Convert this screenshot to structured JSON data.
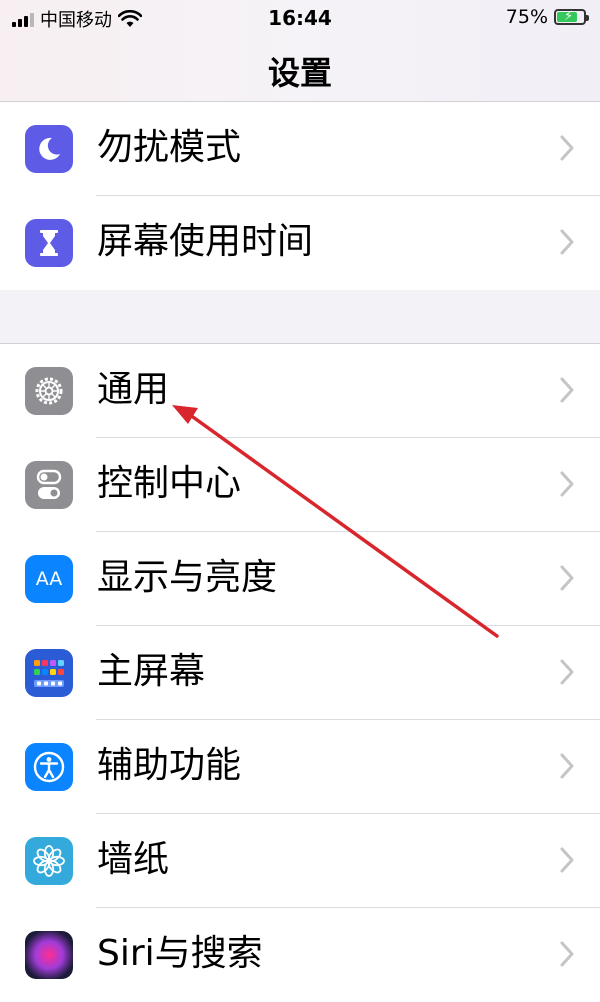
{
  "status": {
    "carrier": "中国移动",
    "time": "16:44",
    "battery_percent": "75%",
    "battery_level": 0.75
  },
  "nav": {
    "title": "设置"
  },
  "group_a": [
    {
      "label": "勿扰模式",
      "icon": "moon-icon",
      "color": "#5e5ce6"
    },
    {
      "label": "屏幕使用时间",
      "icon": "hourglass-icon",
      "color": "#5e5ce6"
    }
  ],
  "group_b": [
    {
      "label": "通用",
      "icon": "gear-icon",
      "color": "#8e8e93"
    },
    {
      "label": "控制中心",
      "icon": "toggle-switches-icon",
      "color": "#8e8e93"
    },
    {
      "label": "显示与亮度",
      "icon": "aa-text-icon",
      "icon_text": "AA",
      "color": "#0a84ff"
    },
    {
      "label": "主屏幕",
      "icon": "home-screen-grid-icon",
      "color": "#2c5bd6"
    },
    {
      "label": "辅助功能",
      "icon": "accessibility-icon",
      "color": "#0a84ff"
    },
    {
      "label": "墙纸",
      "icon": "flower-icon",
      "color": "#34aadc"
    },
    {
      "label": "Siri与搜索",
      "icon": "siri-icon",
      "color": "#1c1c1e"
    }
  ],
  "annotation": {
    "arrow_color": "#d9262c"
  }
}
